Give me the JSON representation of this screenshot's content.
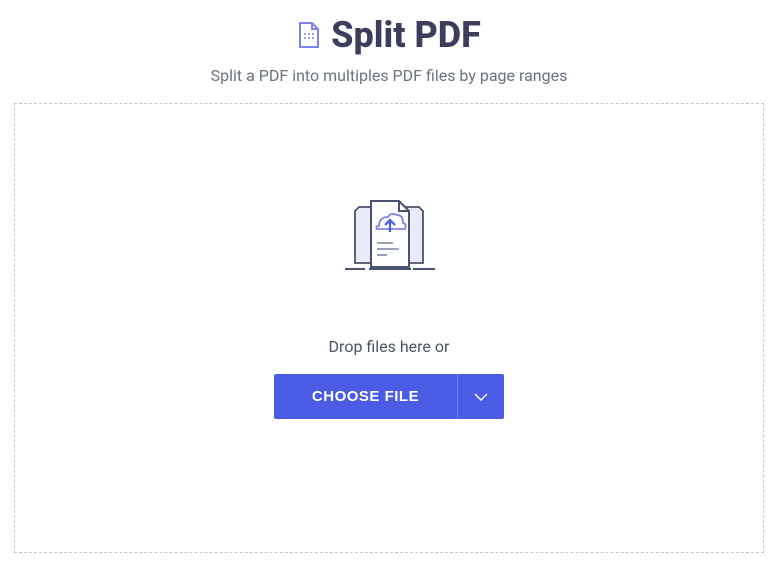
{
  "header": {
    "title": "Split PDF",
    "subtitle": "Split a PDF into multiples PDF files by page ranges"
  },
  "dropzone": {
    "drop_text": "Drop files here or",
    "choose_file_label": "CHOOSE FILE"
  },
  "colors": {
    "primary": "#4a5be6",
    "title_text": "#3d3d5c",
    "body_text": "#6b7280"
  }
}
